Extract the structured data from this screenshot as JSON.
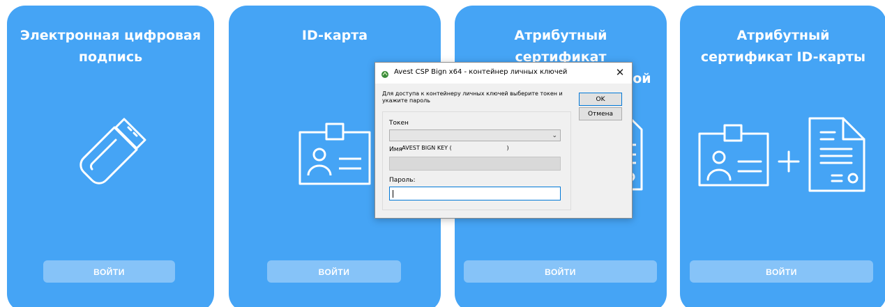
{
  "cards": [
    {
      "title": "Электронная цифровая подпись",
      "button": "ВОЙТИ",
      "icon": "usb-key-icon"
    },
    {
      "title": "ID-карта",
      "button": "ВОЙТИ",
      "icon": "id-badge-icon"
    },
    {
      "title": "Атрибутный сертификат электронной цифровой",
      "button": "ВОЙТИ",
      "icon": "document-icon"
    },
    {
      "title": "Атрибутный сертификат ID-карты",
      "button": "ВОЙТИ",
      "icon": "id-badge-plus-document-icon"
    }
  ],
  "dialog": {
    "title": "Avest CSP Bign x64 - контейнер личных ключей",
    "close": "✕",
    "prompt": "Для доступа к контейнеру личных ключей выберите токен и укажите пароль",
    "ok": "OK",
    "cancel": "Отмена",
    "token_label": "Токен",
    "token_value": "AVEST BIGN KEY (                               )",
    "name_label": "Имя",
    "name_value": "",
    "password_label": "Пароль:",
    "password_value": ""
  },
  "colors": {
    "card": "#45a4f5",
    "dialog_bg": "#f0f0f0",
    "accent": "#0078d7"
  }
}
